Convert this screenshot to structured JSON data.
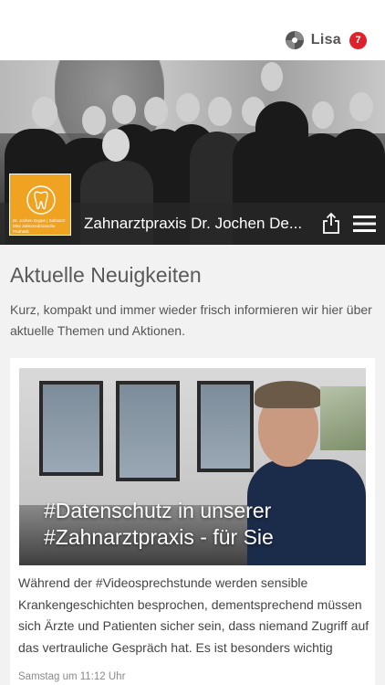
{
  "header": {
    "user_name": "Lisa",
    "notification_count": "7"
  },
  "hero": {
    "practice_name": "Zahnarztpraxis Dr. Jochen De...",
    "logo_text": "Dr. Jochen Doppe | Zahnarzt MSc Zahnmedizinische Prothetik"
  },
  "news": {
    "heading": "Aktuelle Neuigkeiten",
    "intro": "Kurz, kompakt und immer wieder frisch informieren wir hier über aktuelle Themen und Aktionen."
  },
  "post": {
    "headline_line1": "#Datenschutz in unserer",
    "headline_line2": "#Zahnarztpraxis - für Sie",
    "excerpt": "Während der #Videosprechstunde werden sensible Krankengeschichten besprochen, dementsprechend müssen sich Ärzte und Patienten sicher sein, dass niemand Zugriff auf das vertrauliche Gespräch hat. Es ist besonders wichtig",
    "date": "Samstag um 11:12 Uhr"
  }
}
